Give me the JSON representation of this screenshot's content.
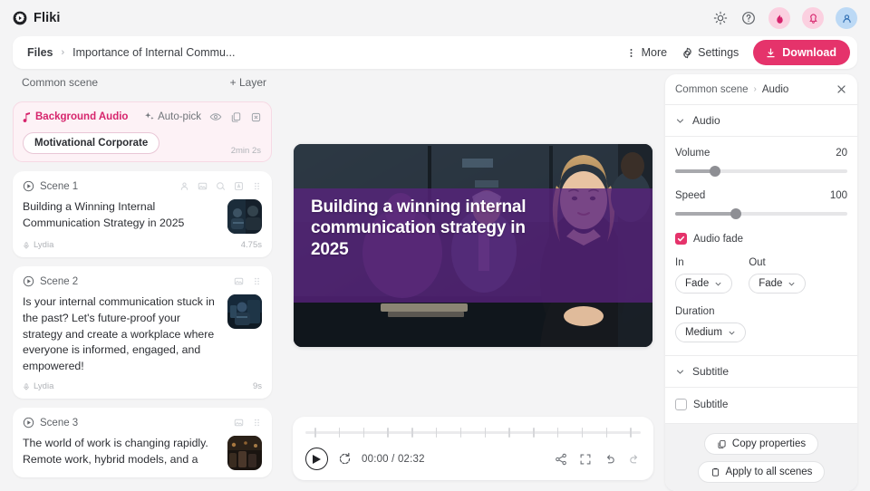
{
  "app": {
    "brand": "Fliki",
    "topbar_icons": [
      "sun-icon",
      "help-icon",
      "flame-icon",
      "bell-icon",
      "avatar-icon"
    ]
  },
  "breadcrumb": {
    "root": "Files",
    "separator": "›",
    "title": "Importance of Internal Commu...",
    "more_label": "More",
    "settings_label": "Settings",
    "download_label": "Download"
  },
  "left_panel": {
    "common_scene_label": "Common scene",
    "add_layer_label": "+ Layer",
    "background_audio": {
      "title": "Background Audio",
      "autopick_label": "Auto-pick",
      "track_name": "Motivational Corporate",
      "duration": "2min 2s",
      "tools": [
        "eye-icon",
        "copy-icon",
        "delete-icon"
      ]
    },
    "scenes": [
      {
        "name": "Scene 1",
        "text": "Building a Winning Internal Communication Strategy in 2025",
        "voice": "Lydia",
        "duration": "4.75s",
        "icons": [
          "person-icon",
          "image-icon",
          "speech-bubble-icon",
          "text-box-icon",
          "drag-handle-icon"
        ]
      },
      {
        "name": "Scene 2",
        "text": "Is your internal communication stuck in the past? Let's future-proof your strategy and create a workplace where everyone is informed, engaged, and empowered!",
        "voice": "Lydia",
        "duration": "9s",
        "icons": [
          "image-icon",
          "drag-handle-icon"
        ]
      },
      {
        "name": "Scene 3",
        "text": "The world of work is changing rapidly. Remote work, hybrid models, and a",
        "voice": "",
        "duration": "",
        "icons": [
          "image-icon",
          "drag-handle-icon"
        ]
      }
    ]
  },
  "preview": {
    "caption": "Building a winning internal communication strategy in 2025",
    "overlay_color": "#58227d"
  },
  "player": {
    "time_display": "00:00 / 02:32",
    "play_label": "play-icon",
    "tick_count": 14,
    "right_icons": [
      "share-icon",
      "fullscreen-icon",
      "undo-icon",
      "redo-icon"
    ]
  },
  "right_panel": {
    "crumb_parent": "Common scene",
    "crumb_sep": "›",
    "crumb_current": "Audio",
    "audio_section": {
      "title": "Audio",
      "volume_label": "Volume",
      "volume_value": "20",
      "volume_percent": 23,
      "speed_label": "Speed",
      "speed_value": "100",
      "speed_percent": 35,
      "audio_fade_label": "Audio fade",
      "audio_fade_checked": true,
      "in_label": "In",
      "in_value": "Fade",
      "out_label": "Out",
      "out_value": "Fade",
      "duration_label": "Duration",
      "duration_value": "Medium"
    },
    "subtitle_section": {
      "title": "Subtitle",
      "checkbox_label": "Subtitle",
      "checked": false
    },
    "copy_properties_label": "Copy properties",
    "apply_all_label": "Apply to all scenes"
  },
  "colors": {
    "accent": "#e5336b",
    "accent_soft": "#fdf2f6",
    "page_bg": "#f4f4f5"
  }
}
